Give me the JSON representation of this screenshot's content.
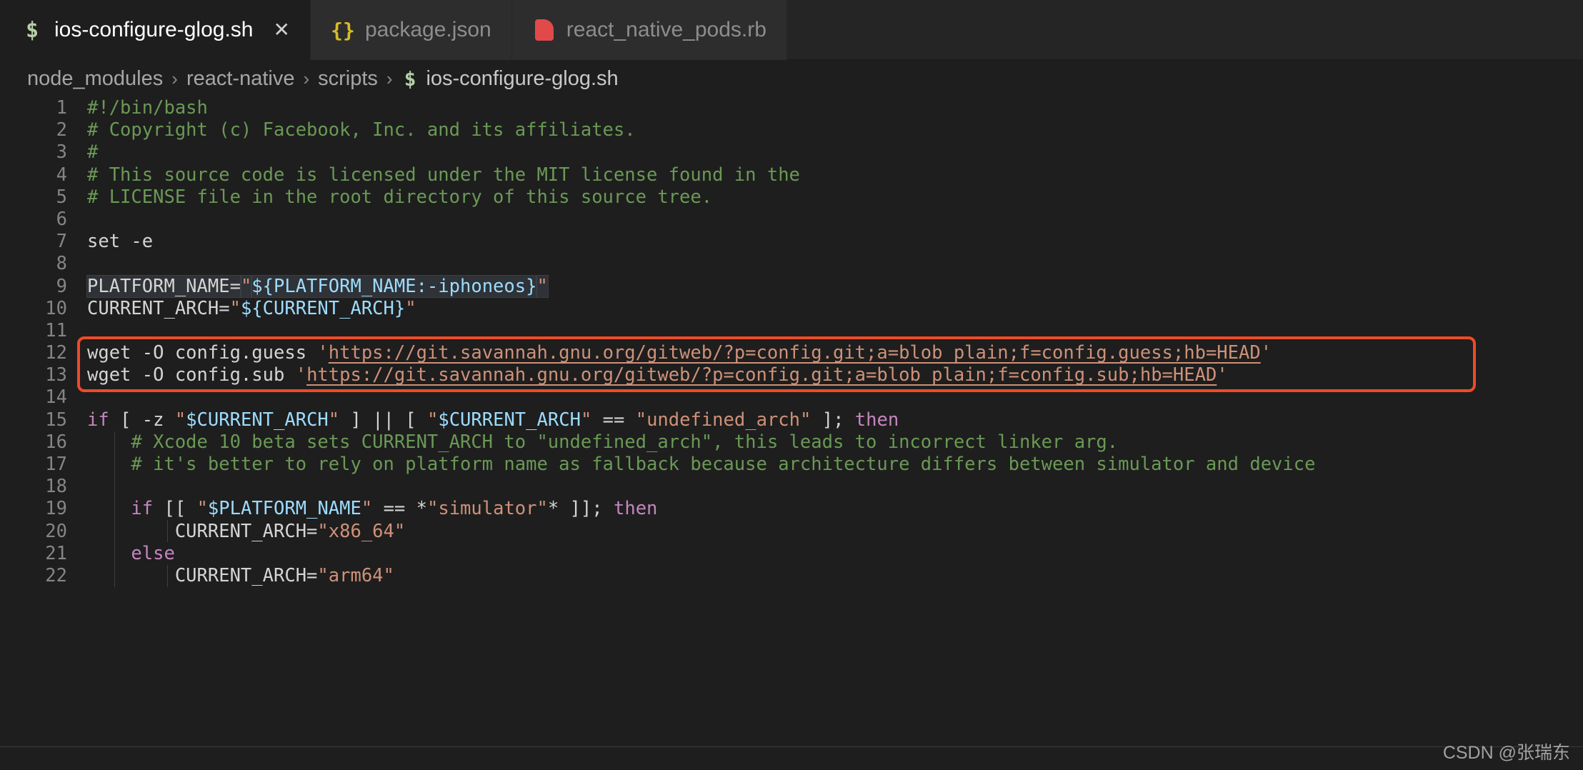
{
  "window": {
    "background": "#1e1e1e",
    "tabbar_background": "#252526",
    "inactive_tab_background": "#2d2d2d"
  },
  "tabs": [
    {
      "label": "ios-configure-glog.sh",
      "icon": "shell-script-icon",
      "icon_glyph": "$",
      "active": true,
      "close_glyph": "✕"
    },
    {
      "label": "package.json",
      "icon": "json-file-icon",
      "icon_glyph": "{}",
      "active": false
    },
    {
      "label": "react_native_pods.rb",
      "icon": "ruby-file-icon",
      "icon_glyph": "",
      "active": false
    }
  ],
  "breadcrumb": {
    "separator": "›",
    "items": [
      {
        "label": "node_modules"
      },
      {
        "label": "react-native"
      },
      {
        "label": "scripts"
      }
    ],
    "file_icon_glyph": "$",
    "file_label": "ios-configure-glog.sh"
  },
  "editor": {
    "language": "shellscript",
    "first_line": 1,
    "colors": {
      "comment": "#6a9955",
      "variable": "#9cdcfe",
      "string": "#ce9178",
      "keyword": "#c586c0",
      "plain": "#d4d4d4",
      "line_number": "#858585",
      "highlight_box": "#f04a28",
      "word_highlight": "#2f3237"
    },
    "lines": [
      {
        "n": "1",
        "tokens": [
          {
            "c": "comment",
            "t": "#!/bin/bash"
          }
        ]
      },
      {
        "n": "2",
        "tokens": [
          {
            "c": "comment",
            "t": "# Copyright (c) Facebook, Inc. and its affiliates."
          }
        ]
      },
      {
        "n": "3",
        "tokens": [
          {
            "c": "comment",
            "t": "#"
          }
        ]
      },
      {
        "n": "4",
        "tokens": [
          {
            "c": "comment",
            "t": "# This source code is licensed under the MIT license found in the"
          }
        ]
      },
      {
        "n": "5",
        "tokens": [
          {
            "c": "comment",
            "t": "# LICENSE file in the root directory of this source tree."
          }
        ]
      },
      {
        "n": "6",
        "tokens": []
      },
      {
        "n": "7",
        "tokens": [
          {
            "c": "plain",
            "t": "set -e"
          }
        ]
      },
      {
        "n": "8",
        "tokens": []
      },
      {
        "n": "9",
        "tokens": [
          {
            "c": "plain hl",
            "t": "PLATFORM_NAME="
          },
          {
            "c": "str hl",
            "t": "\""
          },
          {
            "c": "var hl",
            "t": "${PLATFORM_NAME:-iphoneos}"
          },
          {
            "c": "str hl",
            "t": "\""
          }
        ]
      },
      {
        "n": "10",
        "tokens": [
          {
            "c": "plain",
            "t": "CURRENT_ARCH="
          },
          {
            "c": "str",
            "t": "\""
          },
          {
            "c": "var",
            "t": "${CURRENT_ARCH}"
          },
          {
            "c": "str",
            "t": "\""
          }
        ]
      },
      {
        "n": "11",
        "tokens": []
      },
      {
        "n": "12",
        "tokens": [
          {
            "c": "plain",
            "t": "wget -O config.guess "
          },
          {
            "c": "str",
            "t": "'"
          },
          {
            "c": "link",
            "t": "https://git.savannah.gnu.org/gitweb/?p=config.git;a=blob_plain;f=config.guess;hb=HEAD"
          },
          {
            "c": "str",
            "t": "'"
          }
        ]
      },
      {
        "n": "13",
        "tokens": [
          {
            "c": "plain",
            "t": "wget -O config.sub "
          },
          {
            "c": "str",
            "t": "'"
          },
          {
            "c": "link",
            "t": "https://git.savannah.gnu.org/gitweb/?p=config.git;a=blob_plain;f=config.sub;hb=HEAD"
          },
          {
            "c": "str",
            "t": "'"
          }
        ]
      },
      {
        "n": "14",
        "tokens": []
      },
      {
        "n": "15",
        "tokens": [
          {
            "c": "kw",
            "t": "if"
          },
          {
            "c": "plain",
            "t": " [ -z "
          },
          {
            "c": "str",
            "t": "\""
          },
          {
            "c": "var",
            "t": "$CURRENT_ARCH"
          },
          {
            "c": "str",
            "t": "\""
          },
          {
            "c": "plain",
            "t": " ] || [ "
          },
          {
            "c": "str",
            "t": "\""
          },
          {
            "c": "var",
            "t": "$CURRENT_ARCH"
          },
          {
            "c": "str",
            "t": "\""
          },
          {
            "c": "plain",
            "t": " == "
          },
          {
            "c": "str",
            "t": "\"undefined_arch\""
          },
          {
            "c": "plain",
            "t": " ]; "
          },
          {
            "c": "kw",
            "t": "then"
          }
        ]
      },
      {
        "n": "16",
        "tokens": [
          {
            "c": "comment",
            "t": "    # Xcode 10 beta sets CURRENT_ARCH to \"undefined_arch\", this leads to incorrect linker arg."
          }
        ]
      },
      {
        "n": "17",
        "tokens": [
          {
            "c": "comment",
            "t": "    # it's better to rely on platform name as fallback because architecture differs between simulator and device"
          }
        ]
      },
      {
        "n": "18",
        "tokens": []
      },
      {
        "n": "19",
        "tokens": [
          {
            "c": "plain",
            "t": "    "
          },
          {
            "c": "kw",
            "t": "if"
          },
          {
            "c": "plain",
            "t": " [[ "
          },
          {
            "c": "str",
            "t": "\""
          },
          {
            "c": "var",
            "t": "$PLATFORM_NAME"
          },
          {
            "c": "str",
            "t": "\""
          },
          {
            "c": "plain",
            "t": " == *"
          },
          {
            "c": "str",
            "t": "\"simulator\""
          },
          {
            "c": "plain",
            "t": "* ]]; "
          },
          {
            "c": "kw",
            "t": "then"
          }
        ]
      },
      {
        "n": "20",
        "tokens": [
          {
            "c": "plain",
            "t": "        CURRENT_ARCH="
          },
          {
            "c": "str",
            "t": "\"x86_64\""
          }
        ]
      },
      {
        "n": "21",
        "tokens": [
          {
            "c": "plain",
            "t": "    "
          },
          {
            "c": "kw",
            "t": "else"
          }
        ]
      },
      {
        "n": "22",
        "tokens": [
          {
            "c": "plain",
            "t": "        CURRENT_ARCH="
          },
          {
            "c": "str",
            "t": "\"arm64\""
          }
        ]
      }
    ]
  },
  "watermark": {
    "text": "CSDN @张瑞东"
  }
}
